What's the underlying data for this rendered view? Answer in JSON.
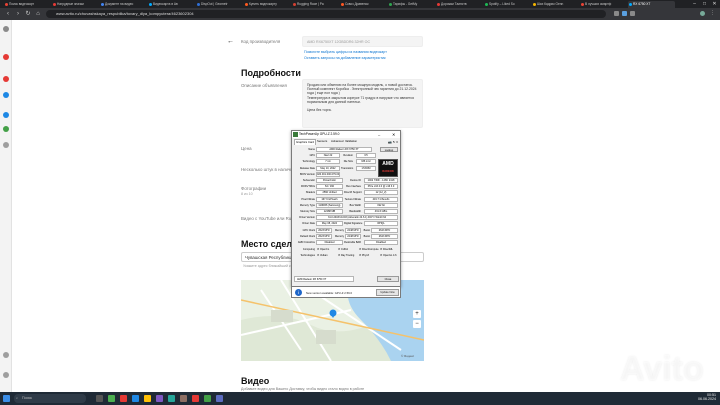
{
  "browser": {
    "tabs": [
      {
        "label": "Поиск видеокарт",
        "color": "#ea4335"
      },
      {
        "label": "Нагрудные значки",
        "color": "#e53935"
      },
      {
        "label": "Документ на видео",
        "color": "#4285f4"
      },
      {
        "label": "Видеокарта в Ав",
        "color": "#00aaff"
      },
      {
        "label": "DispOut | Geometr",
        "color": "#2f6fd6"
      },
      {
        "label": "Купить видеокарту",
        "color": "#ff5a1f"
      },
      {
        "label": "Rugging Race | Pa",
        "color": "#d23f31"
      },
      {
        "label": "Сквоз Дравенок",
        "color": "#ff5722"
      },
      {
        "label": "Тарифы - GetMy",
        "color": "#2ea44f"
      },
      {
        "label": "Дорожки Таинств",
        "color": "#e53935"
      },
      {
        "label": "Spotify – Liked So",
        "color": "#1db954"
      },
      {
        "label": "Шах Кадрик Genn",
        "color": "#f4b400"
      },
      {
        "label": "В лучших смартф",
        "color": "#ea4335"
      },
      {
        "label": "RX 6750 XT",
        "color": "#00aaff"
      }
    ],
    "url": "www.avito.ru/chuvashskaya_respublika/tovary_dlya_kompyutera/4623602304",
    "min_glyph": "–",
    "max_glyph": "□",
    "close_glyph": "✕"
  },
  "form": {
    "manufacturer_code_label": "Код производителя",
    "manufacturer_code_value": "AMD RX6750XT 12GBDDR6 32HR OC",
    "hint_link": "Помогите выбрать цифры из названия видеокарт",
    "characteristics_link": "Оставить запросы на добавление характеристик",
    "details_heading": "Подробности",
    "description_label": "Описание объявления",
    "description_text": "Продаю или обменяю на более мощную модель, о новой достаток.\nПолный комплект Коробка . Электронный чек гарантия до 21.12.2024 года ( еще пол года )\nТемпература в закрытом корпусе 71 градус в нагрузке что является нормальным для данной пательи.\n\nЦена без торга.",
    "price_label": "Цена",
    "quantity_label": "Несколько штук в наличии",
    "photos_label": "Фотографии",
    "photos_count": "8 из 10",
    "video_link_label": "Видео с YouTube или Rutube",
    "deal_place_heading": "Место сделки",
    "location_value": "Чувашская Республика, Чебо",
    "location_hint": "Укажите адрес ближайший к месту сделки",
    "map_note": "© Яндекс",
    "video_heading": "Видео",
    "video_hint": "Добавьте видео для Вашего Доставку, чтобы видео стало видно в работе"
  },
  "gpuz": {
    "title": "TechPowerUp GPU-Z 2.59.0",
    "tabs": [
      "Graphics Card",
      "Sensors",
      "Advanced",
      "Validation"
    ],
    "lookup": "Lookup",
    "rows": [
      {
        "label": "Name",
        "value": "AMD Radeon RX 6750 XT"
      },
      {
        "label": "GPU",
        "value": "Navi 22",
        "l2": "Revision",
        "v2": "C5"
      },
      {
        "label": "Technology",
        "value": "7 nm",
        "l2": "Die Size",
        "v2": "336 mm²"
      },
      {
        "label": "Release Date",
        "value": "May 10, 2022",
        "l2": "Transistors",
        "v2": "17200M"
      },
      {
        "label": "BIOS Version",
        "value": "020.001.000.079.000000",
        "l2": "",
        "v2": "UEFI"
      },
      {
        "label": "Subvendor",
        "value": "PowerColor",
        "l2": "Device ID",
        "v2": "1002 73DF - 148C 2418"
      },
      {
        "label": "ROPs/TMUs",
        "value": "64 / 160",
        "l2": "Bus Interface",
        "v2": "PCIe x16 4.0 @ x16 3.0"
      },
      {
        "label": "Shaders",
        "value": "2560 Unified",
        "l2": "DirectX Support",
        "v2": "12 (12_2)"
      },
      {
        "label": "Pixel Fillrate",
        "value": "167.9 GPixel/s",
        "l2": "Texture Fillrate",
        "v2": "419.7 GTexel/s"
      },
      {
        "label": "Memory Type",
        "value": "GDDR6 (Samsung)",
        "l2": "Bus Width",
        "v2": "192 bit"
      },
      {
        "label": "Memory Size",
        "value": "12288 MB",
        "l2": "Bandwidth",
        "v2": "431.6 GB/s"
      },
      {
        "label": "Driver Version",
        "value": "31.0.24033.1003 (Adrenalin 24.6.1) DCH / Win10 64",
        "l2": "",
        "v2": ""
      },
      {
        "label": "Driver Date",
        "value": "May 08, 2024",
        "l2": "Digital Signature",
        "v2": "WHQL"
      },
      {
        "label": "GPU Clock",
        "value": "2623 MHz",
        "l2": "Memory",
        "v2": "2248 MHz",
        "l3": "Boost",
        "v3": "2623 MHz"
      },
      {
        "label": "Default Clock",
        "value": "2623 MHz",
        "l2": "Memory",
        "v2": "2248 MHz",
        "l3": "Boost",
        "v3": "2623 MHz"
      },
      {
        "label": "AMD CrossFire",
        "value": "Disabled",
        "l2": "Resizable BAR",
        "v2": "Disabled"
      }
    ],
    "computing_label": "Computing",
    "computing": [
      "OpenCL",
      "CUDA",
      "DirectCompute",
      "DirectML"
    ],
    "technologies_label": "Technologies",
    "technologies": [
      "Vulkan",
      "Ray Tracing",
      "PhysX",
      "OpenGL 4.6"
    ],
    "dropdown": "AMD Radeon RX 6750 XT",
    "close": "Close",
    "update_text": "New version available: GPU-Z 2.59.0",
    "update_button": "Update Now"
  },
  "taskbar": {
    "search_placeholder": "Поиск",
    "time": "00:51",
    "date": "06.06.2024"
  },
  "watermark": "Avito"
}
